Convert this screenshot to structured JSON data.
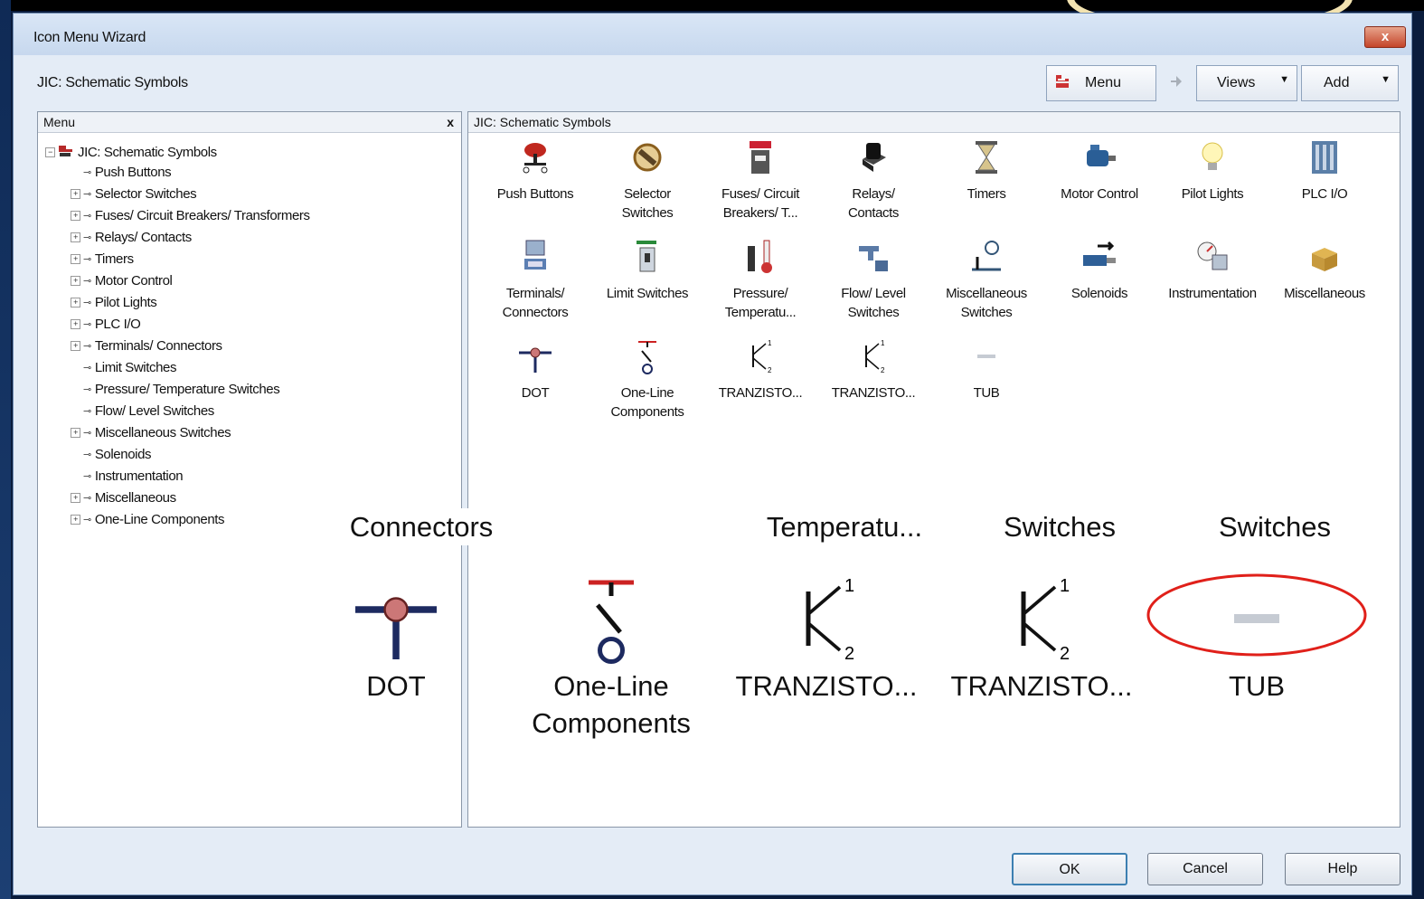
{
  "window": {
    "title": "Icon Menu Wizard",
    "close_label": "x"
  },
  "breadcrumb": "JIC: Schematic Symbols",
  "toolbar": {
    "menu_label": "Menu",
    "views_label": "Views",
    "add_label": "Add"
  },
  "tree_pane": {
    "header": "Menu",
    "close_label": "x",
    "root": "JIC: Schematic Symbols",
    "items": [
      {
        "label": "Push Buttons",
        "expandable": false
      },
      {
        "label": "Selector Switches",
        "expandable": true
      },
      {
        "label": "Fuses/ Circuit Breakers/ Transformers",
        "expandable": true
      },
      {
        "label": "Relays/ Contacts",
        "expandable": true
      },
      {
        "label": "Timers",
        "expandable": true
      },
      {
        "label": "Motor Control",
        "expandable": true
      },
      {
        "label": "Pilot Lights",
        "expandable": true
      },
      {
        "label": "PLC I/O",
        "expandable": true
      },
      {
        "label": "Terminals/ Connectors",
        "expandable": true
      },
      {
        "label": "Limit Switches",
        "expandable": false
      },
      {
        "label": "Pressure/ Temperature Switches",
        "expandable": false
      },
      {
        "label": "Flow/ Level Switches",
        "expandable": false
      },
      {
        "label": "Miscellaneous Switches",
        "expandable": true
      },
      {
        "label": "Solenoids",
        "expandable": false
      },
      {
        "label": "Instrumentation",
        "expandable": false
      },
      {
        "label": "Miscellaneous",
        "expandable": true
      },
      {
        "label": "One-Line Components",
        "expandable": true
      }
    ]
  },
  "icon_pane": {
    "header": "JIC: Schematic Symbols",
    "icons": [
      {
        "l1": "Push Buttons",
        "l2": "",
        "icon": "push-button-icon"
      },
      {
        "l1": "Selector",
        "l2": "Switches",
        "icon": "selector-switch-icon"
      },
      {
        "l1": "Fuses/ Circuit",
        "l2": "Breakers/ T...",
        "icon": "fuse-icon"
      },
      {
        "l1": "Relays/",
        "l2": "Contacts",
        "icon": "relay-icon"
      },
      {
        "l1": "Timers",
        "l2": "",
        "icon": "hourglass-icon"
      },
      {
        "l1": "Motor Control",
        "l2": "",
        "icon": "motor-icon"
      },
      {
        "l1": "Pilot Lights",
        "l2": "",
        "icon": "light-bulb-icon"
      },
      {
        "l1": "PLC I/O",
        "l2": "",
        "icon": "plc-icon"
      },
      {
        "l1": "Terminals/",
        "l2": "Connectors",
        "icon": "terminal-icon"
      },
      {
        "l1": "Limit Switches",
        "l2": "",
        "icon": "limit-switch-icon"
      },
      {
        "l1": "Pressure/",
        "l2": "Temperatu...",
        "icon": "thermometer-icon"
      },
      {
        "l1": "Flow/ Level",
        "l2": "Switches",
        "icon": "faucet-icon"
      },
      {
        "l1": "Miscellaneous",
        "l2": "Switches",
        "icon": "misc-switch-icon"
      },
      {
        "l1": "Solenoids",
        "l2": "",
        "icon": "solenoid-icon"
      },
      {
        "l1": "Instrumentation",
        "l2": "",
        "icon": "gauge-icon"
      },
      {
        "l1": "Miscellaneous",
        "l2": "",
        "icon": "open-box-icon"
      },
      {
        "l1": "DOT",
        "l2": "",
        "icon": "dot-icon"
      },
      {
        "l1": "One-Line",
        "l2": "Components",
        "icon": "one-line-icon"
      },
      {
        "l1": "TRANZISTO...",
        "l2": "",
        "icon": "transistor-icon"
      },
      {
        "l1": "TRANZISTO...",
        "l2": "",
        "icon": "transistor-icon"
      },
      {
        "l1": "TUB",
        "l2": "",
        "icon": "tub-icon"
      }
    ]
  },
  "zoom_overlay": {
    "top_row": [
      {
        "l1": "Connectors"
      },
      {
        "l1": "Temperatu..."
      },
      {
        "l1": "Switches"
      },
      {
        "l1": "Switches"
      }
    ],
    "bottom_row": [
      {
        "l1": "DOT",
        "l2": ""
      },
      {
        "l1": "One-Line",
        "l2": "Components"
      },
      {
        "l1": "TRANZISTO...",
        "l2": ""
      },
      {
        "l1": "TRANZISTO...",
        "l2": ""
      },
      {
        "l1": "TUB",
        "l2": ""
      }
    ],
    "highlight_color": "#e0201a"
  },
  "buttons": {
    "ok": "OK",
    "cancel": "Cancel",
    "help": "Help"
  }
}
